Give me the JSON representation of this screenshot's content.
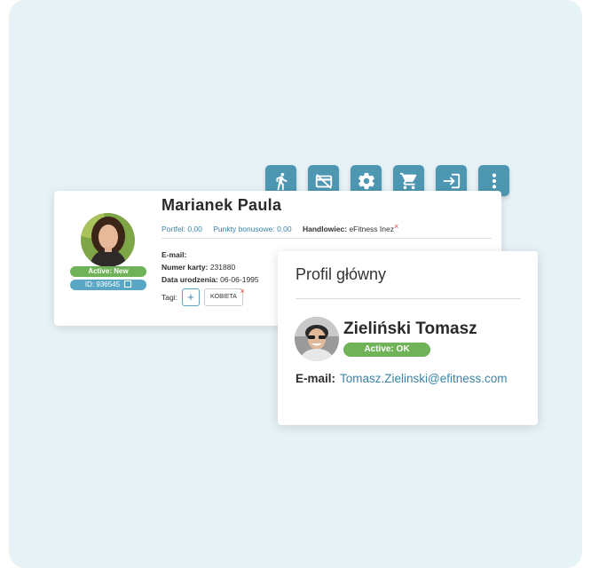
{
  "toolbar": {
    "icons": [
      "walk-icon",
      "card-off-icon",
      "gear-icon",
      "cart-icon",
      "login-icon",
      "more-icon"
    ]
  },
  "client_card": {
    "name": "Marianek Paula",
    "status_badge": "Active: New",
    "id_badge": "ID: 936545",
    "wallet_label": "Portfel:",
    "wallet_value": "0,00",
    "bonus_label": "Punkty bonusowe:",
    "bonus_value": "0,00",
    "salesman_label": "Handlowiec:",
    "salesman_value": "eFitness Inez",
    "remove_mark": "×",
    "email_label": "E-mail:",
    "card_label": "Numer karty:",
    "card_value": "231880",
    "birth_label": "Data urodzenia:",
    "birth_value": "06-06-1995",
    "tags_label": "Tagi:",
    "add_tag_label": "+",
    "tag": "KOBIETA"
  },
  "profile_card": {
    "title": "Profil główny",
    "name": "Zieliński Tomasz",
    "status_badge": "Active: OK",
    "email_label": "E-mail:",
    "email_value": "Tomasz.Zielinski@efitness.com"
  },
  "colors": {
    "background": "#e6f2f6",
    "accent": "#4d97b3",
    "link": "#3a83a8",
    "status_green": "#6fb257",
    "id_blue": "#5aa7c5",
    "remove_red": "#e14545"
  }
}
